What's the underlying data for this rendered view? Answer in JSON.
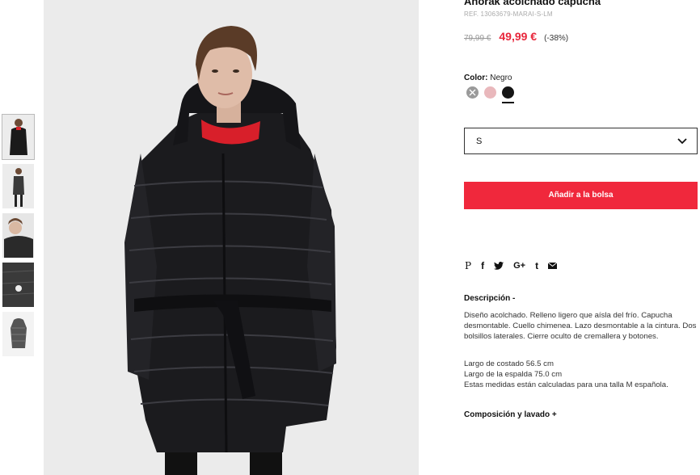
{
  "product": {
    "title": "Anorak acolchado capucha",
    "ref": "REF. 13063679-MARAI-S-LM",
    "old_price": "79,99 €",
    "new_price": "49,99 €",
    "discount": "(-38%)"
  },
  "color": {
    "label": "Color:",
    "selected": "Negro",
    "swatches": [
      {
        "name": "grey",
        "hex": "#9a9a9a",
        "available": false
      },
      {
        "name": "pink",
        "hex": "#e9b8bc",
        "available": true
      },
      {
        "name": "black",
        "hex": "#151515",
        "available": true,
        "selected": true
      }
    ]
  },
  "size": {
    "selected": "S",
    "icon": "chevron-down-icon"
  },
  "add_to_bag": "Añadir a la bolsa",
  "share": {
    "icons": [
      "pinterest-icon",
      "facebook-icon",
      "twitter-icon",
      "google-plus-icon",
      "tumblr-icon",
      "email-icon"
    ],
    "pinterest": "P",
    "facebook": "f",
    "google_plus": "G+",
    "tumblr": "t"
  },
  "description": {
    "heading": "Descripción  -",
    "text": "Diseño acolchado. Relleno ligero que aísla del frío. Capucha desmontable. Cuello chimenea. Lazo desmontable a la cintura. Dos bolsillos laterales. Cierre oculto de cremallera y botones.",
    "measures": [
      "Largo de costado 56.5 cm",
      "Largo de la espalda 75.0 cm",
      "Estas medidas están calculadas para una talla M española."
    ]
  },
  "composition": {
    "heading": "Composición y lavado  +"
  },
  "thumbnails": [
    "front",
    "back",
    "closeup",
    "detail",
    "flat"
  ]
}
